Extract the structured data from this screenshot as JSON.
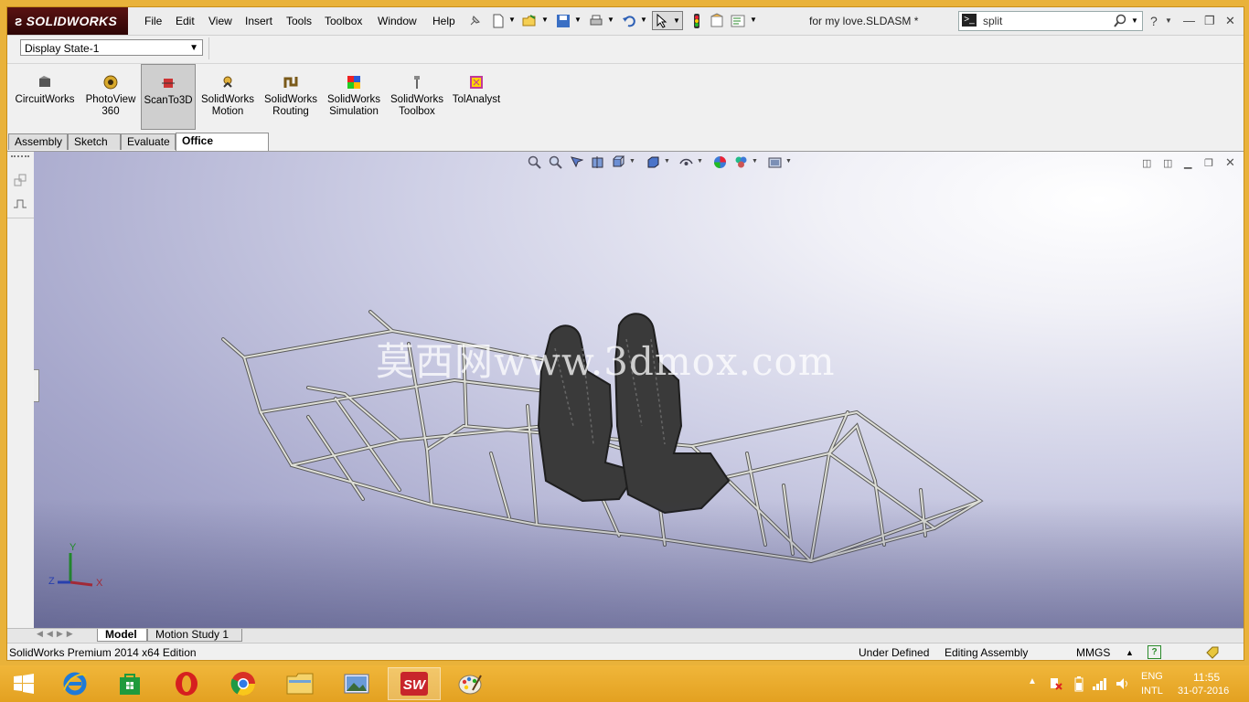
{
  "app": {
    "brand": "SOLIDWORKS",
    "document_title": "for my love.SLDASM *"
  },
  "menu": [
    "File",
    "Edit",
    "View",
    "Insert",
    "Tools",
    "Toolbox",
    "Window",
    "Help"
  ],
  "search": {
    "value": "split"
  },
  "display_state": {
    "selected": "Display State-1"
  },
  "command_manager": [
    {
      "label": "CircuitWorks"
    },
    {
      "label": "PhotoView\n360"
    },
    {
      "label": "ScanTo3D"
    },
    {
      "label": "SolidWorks\nMotion"
    },
    {
      "label": "SolidWorks\nRouting"
    },
    {
      "label": "SolidWorks\nSimulation"
    },
    {
      "label": "SolidWorks\nToolbox"
    },
    {
      "label": "TolAnalyst"
    }
  ],
  "tabs": [
    "Assembly",
    "Sketch",
    "Evaluate",
    "Office Products"
  ],
  "active_tab": "Office Products",
  "active_command": "ScanTo3D",
  "watermark": "莫西网www.3dmox.com",
  "triad": {
    "x": "X",
    "y": "Y",
    "z": "Z"
  },
  "bottom_tabs": [
    "Model",
    "Motion Study 1"
  ],
  "status": {
    "edition": "SolidWorks Premium 2014 x64 Edition",
    "definition": "Under Defined",
    "mode": "Editing Assembly",
    "units": "MMGS"
  },
  "tray": {
    "lang1": "ENG",
    "lang2": "INTL",
    "time": "11:55",
    "date": "31-07-2016"
  },
  "colors": {
    "accent": "#e9aa2b",
    "logo_bg": "#4a0c0c",
    "frame": "#dfe0d8",
    "seat": "#3a3a3a"
  }
}
